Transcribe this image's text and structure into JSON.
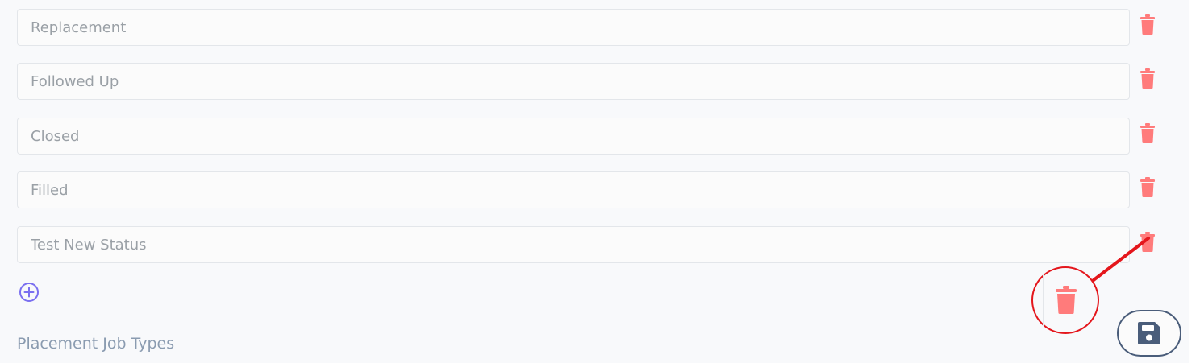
{
  "statuses": [
    {
      "value": "Replacement"
    },
    {
      "value": "Followed Up"
    },
    {
      "value": "Closed"
    },
    {
      "value": "Filled"
    },
    {
      "value": "Test New Status"
    }
  ],
  "icons": {
    "delete": "trash-icon",
    "add": "plus-circle-icon",
    "save": "floppy-disk-icon"
  },
  "section": {
    "next_title": "Placement Job Types"
  },
  "colors": {
    "trash": "#ff7b7b",
    "add": "#7a6ff0",
    "callout": "#e4161c",
    "save": "#4a5d7a",
    "section_title": "#8a9bb0"
  }
}
